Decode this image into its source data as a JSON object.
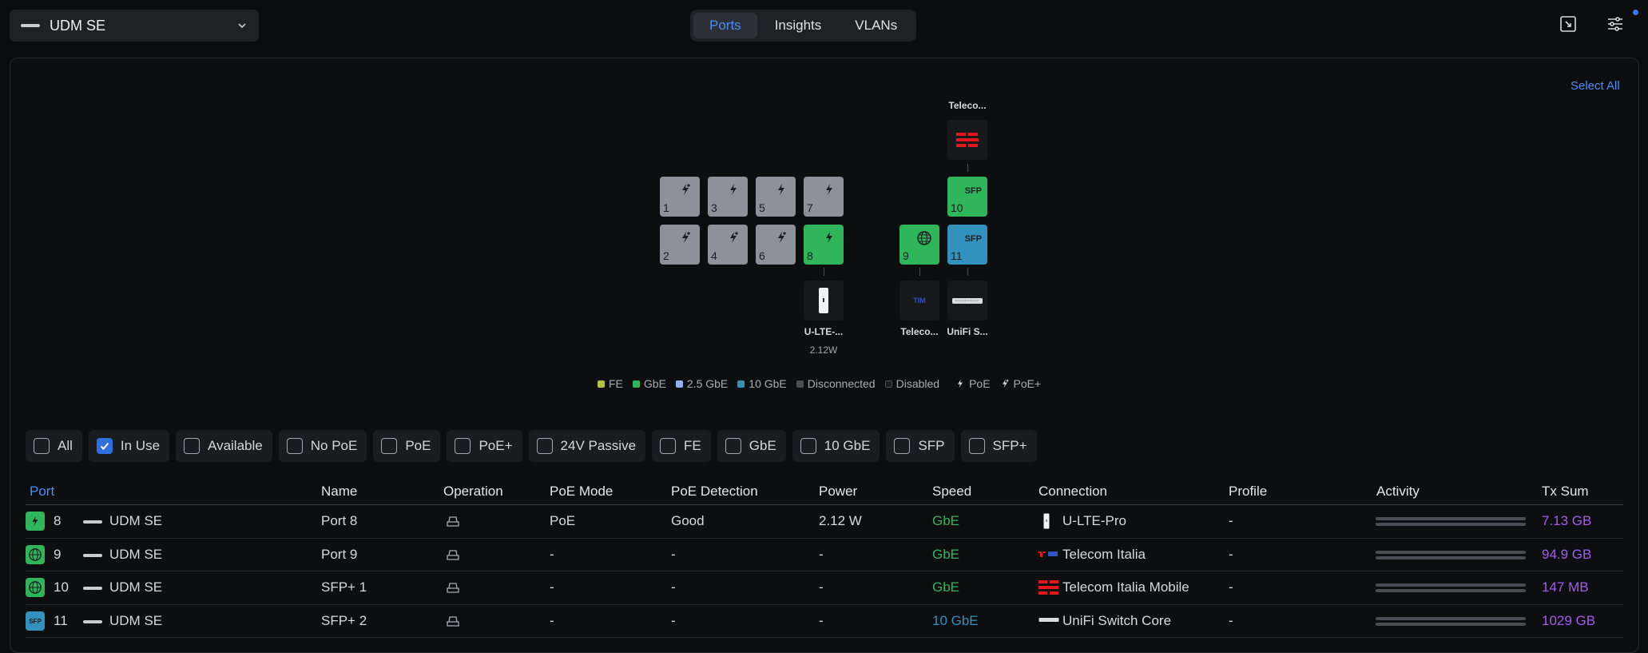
{
  "device_selector": {
    "label": "UDM SE",
    "icon": "gateway-icon"
  },
  "tabs": [
    {
      "label": "Ports",
      "active": true
    },
    {
      "label": "Insights",
      "active": false
    },
    {
      "label": "VLANs",
      "active": false
    }
  ],
  "toolbar_icons": [
    "expand-icon",
    "settings-sliders-icon"
  ],
  "panel": {
    "select_all": "Select All",
    "ports": [
      {
        "num": "1",
        "state": "disabled",
        "poe": "PoE+"
      },
      {
        "num": "2",
        "state": "disabled",
        "poe": "PoE+"
      },
      {
        "num": "3",
        "state": "disabled",
        "poe": "PoE"
      },
      {
        "num": "4",
        "state": "disabled",
        "poe": "PoE+"
      },
      {
        "num": "5",
        "state": "disabled",
        "poe": "PoE"
      },
      {
        "num": "6",
        "state": "disabled",
        "poe": "PoE+"
      },
      {
        "num": "7",
        "state": "disabled",
        "poe": "PoE"
      },
      {
        "num": "8",
        "state": "GbE",
        "poe": "PoE"
      },
      {
        "num": "9",
        "state": "GbE",
        "icon": "globe-icon"
      },
      {
        "num": "10",
        "state": "GbE",
        "badge": "SFP"
      },
      {
        "num": "11",
        "state": "10 GbE",
        "badge": "SFP"
      }
    ],
    "connected_devices": {
      "port8": {
        "label": "U-LTE-...",
        "sub": "2.12W"
      },
      "port9": {
        "label": "Teleco...",
        "logo": "TIM"
      },
      "port10": {
        "label": "Teleco..."
      },
      "port11": {
        "label": "UniFi S..."
      }
    },
    "legend": [
      {
        "label": "FE",
        "color": "#b5c23b"
      },
      {
        "label": "GbE",
        "color": "#2fb65a"
      },
      {
        "label": "2.5 GbE",
        "color": "#8fb2ee"
      },
      {
        "label": "10 GbE",
        "color": "#3391bd"
      },
      {
        "label": "Disconnected",
        "color": "#4a4d54"
      },
      {
        "label": "Disabled",
        "color": "#1b1c20"
      },
      {
        "label": "PoE"
      },
      {
        "label": "PoE+"
      }
    ]
  },
  "filters": [
    {
      "label": "All",
      "checked": false
    },
    {
      "label": "In Use",
      "checked": true
    },
    {
      "label": "Available",
      "checked": false
    },
    {
      "label": "No PoE",
      "checked": false
    },
    {
      "label": "PoE",
      "checked": false
    },
    {
      "label": "PoE+",
      "checked": false
    },
    {
      "label": "24V Passive",
      "checked": false
    },
    {
      "label": "FE",
      "checked": false
    },
    {
      "label": "GbE",
      "checked": false
    },
    {
      "label": "10 GbE",
      "checked": false
    },
    {
      "label": "SFP",
      "checked": false
    },
    {
      "label": "SFP+",
      "checked": false
    }
  ],
  "table": {
    "headers": {
      "port": "Port",
      "name": "Name",
      "operation": "Operation",
      "poe_mode": "PoE Mode",
      "poe_detection": "PoE Detection",
      "power": "Power",
      "speed": "Speed",
      "connection": "Connection",
      "profile": "Profile",
      "activity": "Activity",
      "tx_sum": "Tx Sum"
    },
    "rows": [
      {
        "port": "8",
        "device": "UDM SE",
        "name": "Port 8",
        "poe_mode": "PoE",
        "poe_detection": "Good",
        "power": "2.12 W",
        "speed": "GbE",
        "connection": "U-LTE-Pro",
        "profile": "-",
        "tx_sum": "7.13 GB"
      },
      {
        "port": "9",
        "device": "UDM SE",
        "name": "Port 9",
        "poe_mode": "-",
        "poe_detection": "-",
        "power": "-",
        "speed": "GbE",
        "connection": "Telecom Italia",
        "profile": "-",
        "tx_sum": "94.9 GB"
      },
      {
        "port": "10",
        "device": "UDM SE",
        "name": "SFP+ 1",
        "poe_mode": "-",
        "poe_detection": "-",
        "power": "-",
        "speed": "GbE",
        "connection": "Telecom Italia Mobile",
        "profile": "-",
        "tx_sum": "147 MB"
      },
      {
        "port": "11",
        "device": "UDM SE",
        "name": "SFP+ 2",
        "poe_mode": "-",
        "poe_detection": "-",
        "power": "-",
        "speed": "10 GbE",
        "connection": "UniFi Switch Core",
        "profile": "-",
        "tx_sum": "1029 GB"
      }
    ]
  },
  "colors": {
    "accent": "#4c8df6",
    "gbe": "#2fb65a",
    "ten_gbe": "#3391bd",
    "tx": "#a25cf0"
  }
}
